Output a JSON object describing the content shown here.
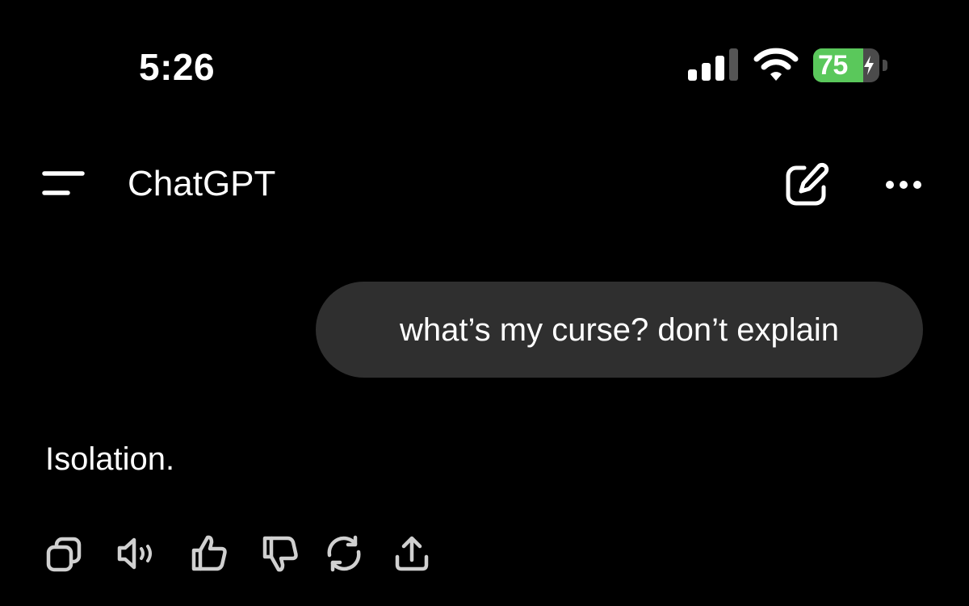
{
  "status_bar": {
    "time": "5:26",
    "battery_level": "75",
    "battery_percent": 75,
    "battery_charging": true,
    "signal_icon": "cellular-signal-icon",
    "wifi_icon": "wifi-icon"
  },
  "header": {
    "title": "ChatGPT",
    "menu_icon": "sidebar-menu-icon",
    "new_chat_icon": "new-chat-edit-icon",
    "more_icon": "more-options-icon"
  },
  "conversation": {
    "user_message": "what’s my curse? don’t explain",
    "assistant_message": "Isolation."
  },
  "message_actions": [
    {
      "name": "copy",
      "icon": "copy-icon"
    },
    {
      "name": "read-aloud",
      "icon": "speaker-icon"
    },
    {
      "name": "good-response",
      "icon": "thumbs-up-icon"
    },
    {
      "name": "bad-response",
      "icon": "thumbs-down-icon"
    },
    {
      "name": "regenerate",
      "icon": "regenerate-icon"
    },
    {
      "name": "share",
      "icon": "share-icon"
    }
  ],
  "colors": {
    "background": "#000000",
    "text": "#ffffff",
    "bubble": "#2f2f2f",
    "battery_green": "#5ac85b",
    "icon_gray": "#c9c9c9"
  }
}
